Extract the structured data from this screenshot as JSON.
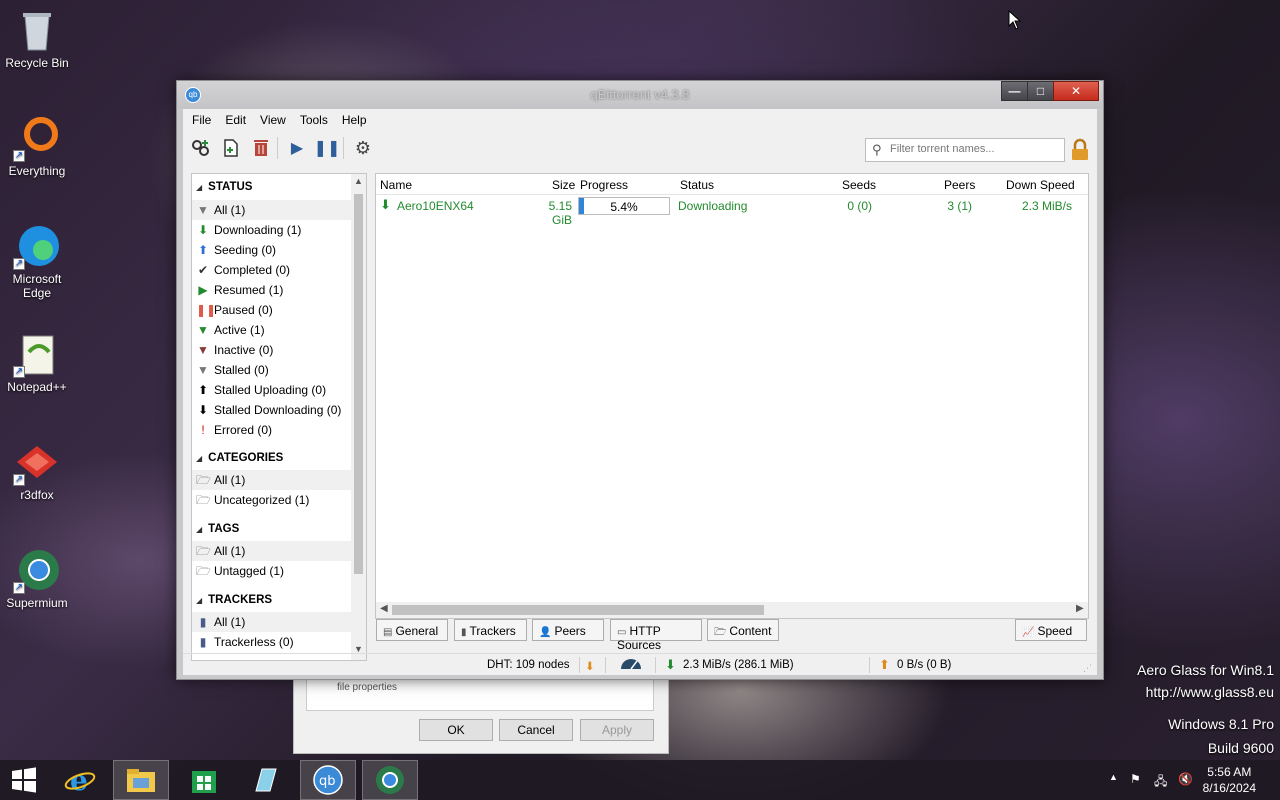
{
  "desktop": {
    "icons": [
      {
        "label": "Recycle Bin"
      },
      {
        "label": "Everything"
      },
      {
        "label": "Microsoft Edge"
      },
      {
        "label": "Notepad++"
      },
      {
        "label": "r3dfox"
      },
      {
        "label": "Supermium"
      }
    ],
    "watermark": {
      "line1": "Aero Glass for Win8.1",
      "line2": "http://www.glass8.eu",
      "line3": "Windows 8.1 Pro",
      "line4": "Build 9600"
    }
  },
  "bg_dialog": {
    "text": "file properties",
    "ok": "OK",
    "cancel": "Cancel",
    "apply": "Apply"
  },
  "window": {
    "title": "qBittorrent v4.3.8",
    "min_glyph": "—",
    "max_glyph": "□",
    "close_glyph": "✕",
    "menu": [
      "File",
      "Edit",
      "View",
      "Tools",
      "Help"
    ],
    "toolbar": {
      "add_link_icon": "link-icon",
      "add_file_icon": "document-icon",
      "delete_icon": "trash-icon",
      "resume_icon": "play-icon",
      "pause_icon": "pause-icon",
      "options_icon": "gear-icon"
    },
    "filter_placeholder": "Filter torrent names..."
  },
  "sidebar": {
    "status_header": "STATUS",
    "status_items": [
      {
        "label": "All (1)",
        "icon": "▼",
        "color": "#777777"
      },
      {
        "label": "Downloading (1)",
        "icon": "⬇",
        "color": "#238a2e"
      },
      {
        "label": "Seeding (0)",
        "icon": "⬆",
        "color": "#2f6fd8"
      },
      {
        "label": "Completed (0)",
        "icon": "✔",
        "color": "#333333"
      },
      {
        "label": "Resumed (1)",
        "icon": "▶",
        "color": "#238a2e"
      },
      {
        "label": "Paused (0)",
        "icon": "❚❚",
        "color": "#e05a4a"
      },
      {
        "label": "Active (1)",
        "icon": "▼",
        "color": "#238a2e"
      },
      {
        "label": "Inactive (0)",
        "icon": "▼",
        "color": "#8b3a3a"
      },
      {
        "label": "Stalled (0)",
        "icon": "▼",
        "color": "#777777"
      },
      {
        "label": "Stalled Uploading (0)",
        "icon": "⬆",
        "color": "#000000"
      },
      {
        "label": "Stalled Downloading (0)",
        "icon": "⬇",
        "color": "#000000"
      },
      {
        "label": "Errored (0)",
        "icon": "!",
        "color": "#d01010"
      }
    ],
    "categories_header": "CATEGORIES",
    "categories": [
      "All (1)",
      "Uncategorized (1)"
    ],
    "tags_header": "TAGS",
    "tags": [
      "All (1)",
      "Untagged (1)"
    ],
    "trackers_header": "TRACKERS",
    "trackers": [
      "All (1)",
      "Trackerless (0)"
    ]
  },
  "table": {
    "columns": [
      "Name",
      "Size",
      "Progress",
      "Status",
      "Seeds",
      "Peers",
      "Down Speed"
    ],
    "rows": [
      {
        "name": "Aero10ENX64",
        "size": "5.15 GiB",
        "progress": "5.4%",
        "progress_value": 0.054,
        "status": "Downloading",
        "seeds": "0 (0)",
        "peers": "3 (1)",
        "down_speed": "2.3 MiB/s"
      }
    ]
  },
  "tabs": [
    "General",
    "Trackers",
    "Peers",
    "HTTP Sources",
    "Content",
    "Speed"
  ],
  "statusbar": {
    "dht": "DHT: 109 nodes",
    "down": "2.3 MiB/s (286.1 MiB)",
    "up": "0 B/s (0 B)"
  },
  "taskbar": {
    "time": "5:56 AM",
    "date": "8/16/2024"
  }
}
